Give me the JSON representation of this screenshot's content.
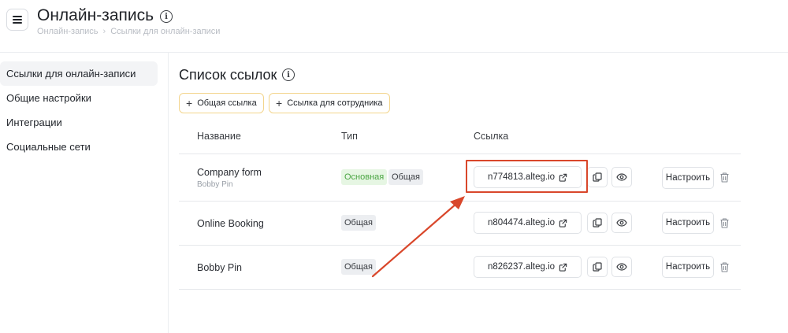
{
  "header": {
    "title": "Онлайн-запись",
    "breadcrumb": [
      "Онлайн-запись",
      "Ссылки для онлайн-записи"
    ]
  },
  "sidebar": {
    "items": [
      {
        "label": "Ссылки для онлайн-записи",
        "active": true
      },
      {
        "label": "Общие настройки"
      },
      {
        "label": "Интеграции"
      },
      {
        "label": "Социальные сети"
      }
    ]
  },
  "main": {
    "section_title": "Список ссылок",
    "buttons": {
      "add_general": "Общая ссылка",
      "add_employee": "Ссылка для сотрудника"
    },
    "table": {
      "headers": [
        "Название",
        "Тип",
        "Ссылка"
      ],
      "rows": [
        {
          "name": "Company form",
          "subname": "Bobby Pin",
          "badges": [
            "Основная",
            "Общая"
          ],
          "link": "n774813.alteg.io",
          "configure": "Настроить"
        },
        {
          "name": "Online Booking",
          "subname": "",
          "badges": [
            "Общая"
          ],
          "link": "n804474.alteg.io",
          "configure": "Настроить"
        },
        {
          "name": "Bobby Pin",
          "subname": "",
          "badges": [
            "Общая"
          ],
          "link": "n826237.alteg.io",
          "configure": "Настроить"
        }
      ]
    }
  },
  "colors": {
    "accent_border": "#f3d58c",
    "annotation": "#d9472b",
    "badge_main_bg": "#e6f6e3",
    "badge_main_text": "#4aa542"
  },
  "icons": [
    "menu-icon",
    "info-icon",
    "chevron-right-icon",
    "plus-icon",
    "external-link-icon",
    "copy-icon",
    "eye-icon",
    "trash-icon"
  ]
}
